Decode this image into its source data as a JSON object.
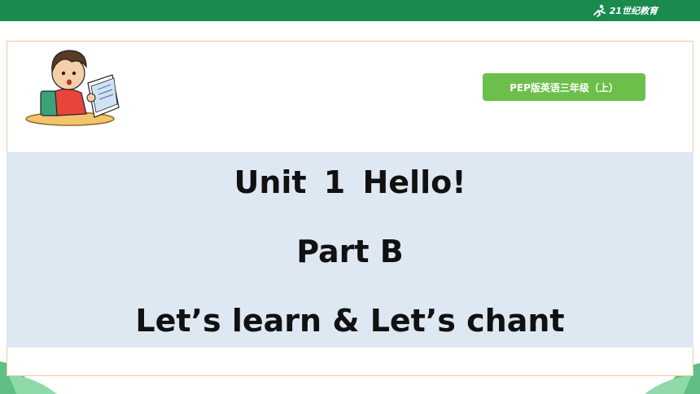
{
  "header": {
    "logo_text": "21世纪教育"
  },
  "badge": {
    "label": "PEP版英语三年级（上）"
  },
  "title": {
    "line1": "Unit 1  Hello!",
    "line2": "Part B",
    "line3": "Let’s learn & Let’s chant"
  },
  "colors": {
    "top_bar": "#1a8a4f",
    "badge": "#6cbf4a",
    "band": "#dde8f2",
    "frame_border": "#f2c99a"
  }
}
